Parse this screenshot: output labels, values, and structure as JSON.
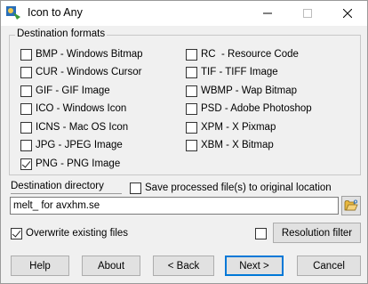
{
  "window": {
    "title": "Icon to Any",
    "minimize_symbol": "—",
    "maximize_symbol": "☐",
    "close_symbol": "✕"
  },
  "formats": {
    "legend": "Destination formats",
    "left": [
      {
        "label": "BMP - Windows Bitmap",
        "checked": false
      },
      {
        "label": "CUR - Windows Cursor",
        "checked": false
      },
      {
        "label": "GIF - GIF Image",
        "checked": false
      },
      {
        "label": "ICO - Windows Icon",
        "checked": false
      },
      {
        "label": "ICNS - Mac OS Icon",
        "checked": false
      },
      {
        "label": "JPG - JPEG Image",
        "checked": false
      },
      {
        "label": "PNG - PNG Image",
        "checked": true
      }
    ],
    "right": [
      {
        "label": "RC  - Resource Code",
        "checked": false
      },
      {
        "label": "TIF - TIFF Image",
        "checked": false
      },
      {
        "label": "WBMP - Wap Bitmap",
        "checked": false
      },
      {
        "label": "PSD - Adobe Photoshop",
        "checked": false
      },
      {
        "label": "XPM - X Pixmap",
        "checked": false
      },
      {
        "label": "XBM - X Bitmap",
        "checked": false
      }
    ]
  },
  "destination": {
    "label": "Destination directory",
    "save_to_original_label": "Save processed file(s) to original location",
    "save_to_original_checked": false,
    "value": "melt_ for avxhm.se"
  },
  "options": {
    "overwrite_label": "Overwrite existing files",
    "overwrite_checked": true,
    "resolution_filter_checked": false,
    "resolution_filter_label": "Resolution filter"
  },
  "buttons": {
    "help": "Help",
    "about": "About",
    "back": "< Back",
    "next": "Next >",
    "cancel": "Cancel"
  },
  "colors": {
    "accent": "#0078d7",
    "folder": "#e8b73e"
  }
}
